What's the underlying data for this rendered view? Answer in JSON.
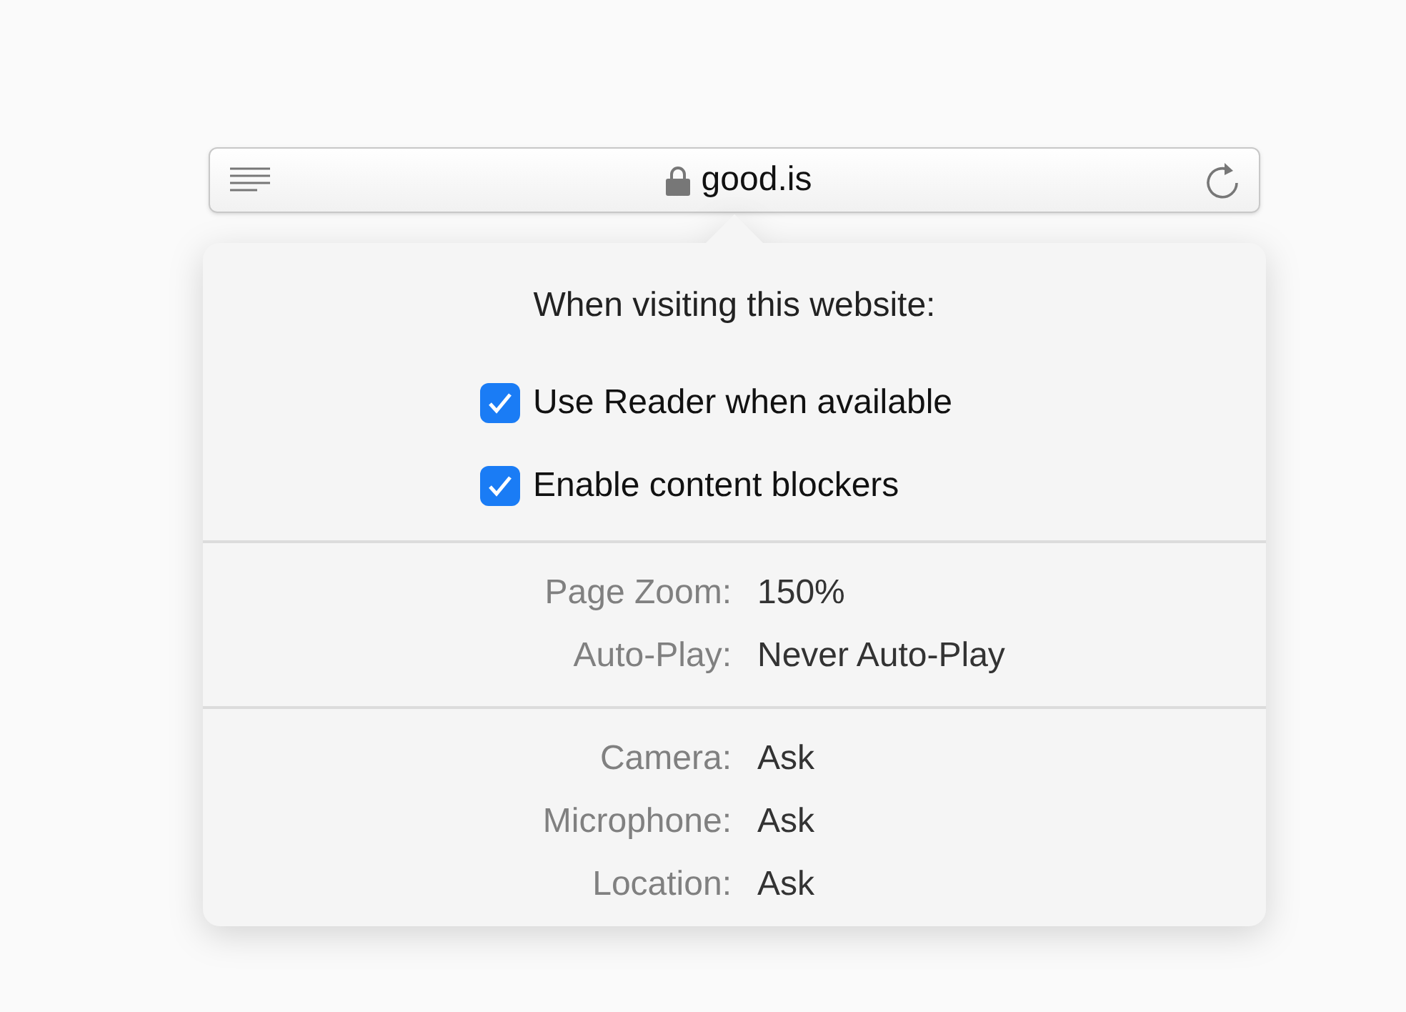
{
  "address_bar": {
    "url": "good.is",
    "secure": true
  },
  "popover": {
    "title": "When visiting this website:",
    "options": [
      {
        "label": "Use Reader when available",
        "checked": true
      },
      {
        "label": "Enable content blockers",
        "checked": true
      }
    ],
    "sections": [
      {
        "rows": [
          {
            "label": "Page Zoom:",
            "value": "150%"
          },
          {
            "label": "Auto-Play:",
            "value": "Never Auto-Play"
          }
        ]
      },
      {
        "rows": [
          {
            "label": "Camera:",
            "value": "Ask"
          },
          {
            "label": "Microphone:",
            "value": "Ask"
          },
          {
            "label": "Location:",
            "value": "Ask"
          }
        ]
      }
    ]
  }
}
